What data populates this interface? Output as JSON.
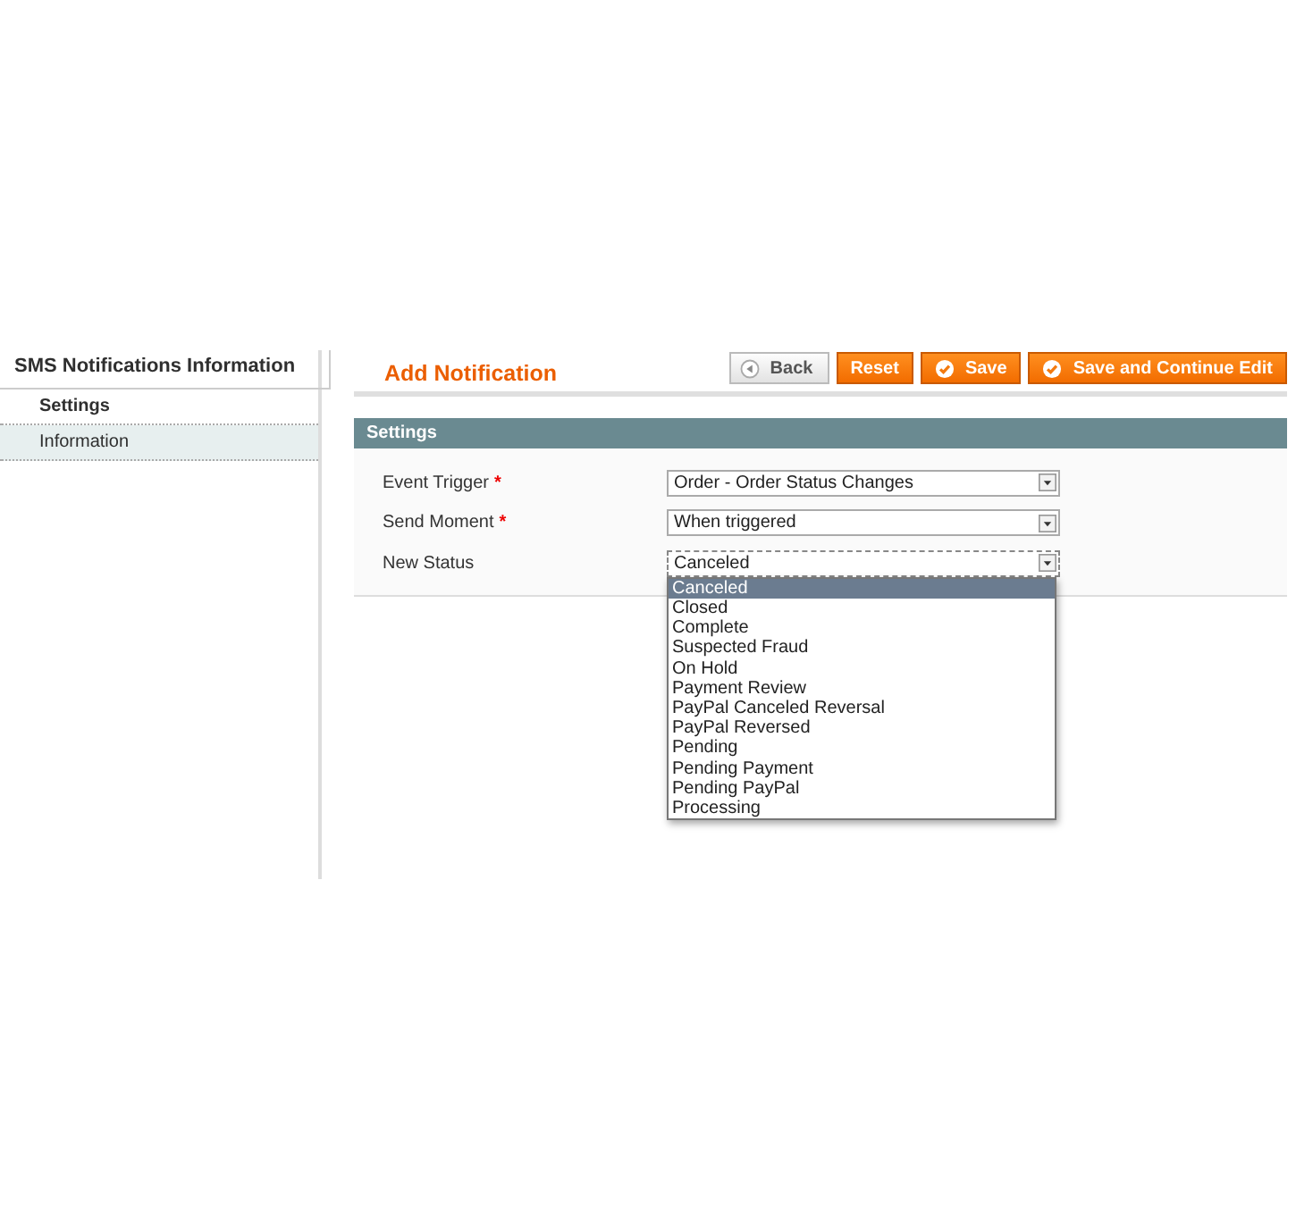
{
  "sidebar": {
    "title": "SMS Notifications Information",
    "tabs": [
      {
        "label": "Settings",
        "selected": true
      },
      {
        "label": "Information",
        "selected": false
      }
    ]
  },
  "header": {
    "title": "Add Notification",
    "buttons": [
      {
        "label": "Back",
        "kind": "back"
      },
      {
        "label": "Reset",
        "kind": "plain"
      },
      {
        "label": "Save",
        "kind": "check"
      },
      {
        "label": "Save and Continue Edit",
        "kind": "check"
      }
    ]
  },
  "section": {
    "title": "Settings",
    "fields": [
      {
        "label": "Event Trigger",
        "required_mark": "*",
        "value": "Order - Order Status Changes",
        "expanded": false
      },
      {
        "label": "Send Moment",
        "required_mark": "*",
        "value": "When triggered",
        "expanded": false
      },
      {
        "label": "New Status",
        "value": "Canceled",
        "expanded": true
      }
    ]
  },
  "dropdown_options": [
    {
      "label": "Canceled",
      "selected": true
    },
    {
      "label": "Closed",
      "selected": false
    },
    {
      "label": "Complete",
      "selected": false
    },
    {
      "label": "Suspected Fraud",
      "selected": false
    },
    {
      "label": "On Hold",
      "selected": false
    },
    {
      "label": "Payment Review",
      "selected": false
    },
    {
      "label": "PayPal Canceled Reversal",
      "selected": false
    },
    {
      "label": "PayPal Reversed",
      "selected": false
    },
    {
      "label": "Pending",
      "selected": false
    },
    {
      "label": "Pending Payment",
      "selected": false
    },
    {
      "label": "Pending PayPal",
      "selected": false
    },
    {
      "label": "Processing",
      "selected": false
    }
  ]
}
